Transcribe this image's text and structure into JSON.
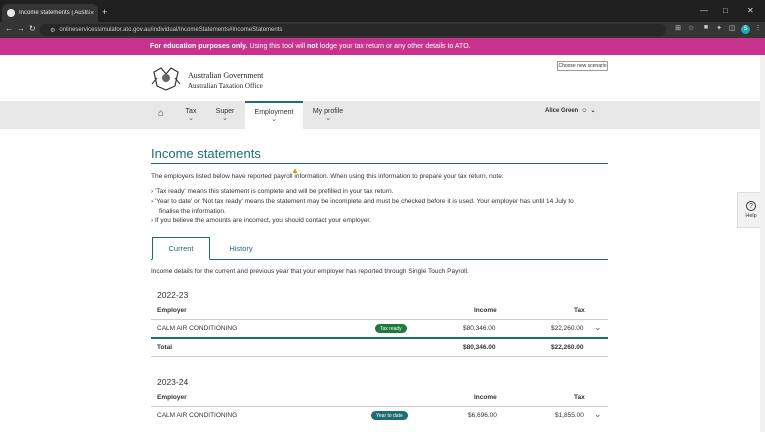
{
  "browser": {
    "tab_title": "Income statements | Australian T",
    "tab_close": "×",
    "new_tab": "+",
    "url": "onlineservicessimulator.ato.gov.au/individual/IncomeStatements#IncomeStatements",
    "profile_initial": "S"
  },
  "banner": {
    "bold": "For education purposes only.",
    "text1": " Using this tool will ",
    "not": "not",
    "text2": " lodge your tax return or any other details to ATO."
  },
  "header": {
    "gov_line1": "Australian Government",
    "gov_line2": "Australian Taxation Office",
    "scenario_button": "Choose new scenario"
  },
  "nav": {
    "items": [
      {
        "label": "Tax"
      },
      {
        "label": "Super"
      },
      {
        "label": "Employment"
      },
      {
        "label": "My profile"
      }
    ],
    "user_name": "Alice Green"
  },
  "page": {
    "title": "Income statements",
    "intro": "The employers listed below have reported payroll information. When using this information to prepare your tax return, note:",
    "bullets": [
      "'Tax ready' means this statement is complete and will be prefilled in your tax return.",
      "'Year to date' or 'Not tax ready' means the statement may be incomplete and must be checked before it is used. Your employer has until 14 July to",
      "finalise the information.",
      "If you believe the amounts are incorrect, you should contact your employer."
    ],
    "tabs": {
      "current": "Current",
      "history": "History"
    },
    "details": "Income details for the current and previous year that your employer has reported through Single Touch Payroll.",
    "table_headers": {
      "employer": "Employer",
      "income": "Income",
      "tax": "Tax"
    },
    "years": [
      {
        "year": "2022-23",
        "rows": [
          {
            "employer": "CALM AIR CONDITIONING",
            "status": "Tax ready",
            "income": "$80,346.00",
            "tax": "$22,260.00"
          }
        ],
        "total_label": "Total",
        "total_income": "$80,346.00",
        "total_tax": "$22,260.00"
      },
      {
        "year": "2023-24",
        "rows": [
          {
            "employer": "CALM AIR CONDITIONING",
            "status": "Year to date",
            "income": "$6,696.00",
            "tax": "$1,855.00"
          }
        ]
      }
    ]
  },
  "help": {
    "label": "Help"
  }
}
